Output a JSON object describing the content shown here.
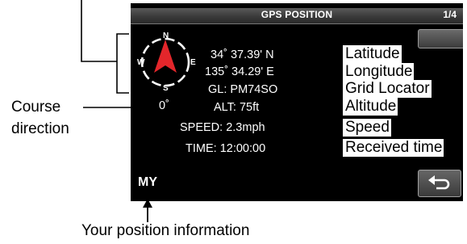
{
  "screen": {
    "title": "GPS POSITION",
    "page": "1/4",
    "latitude": "34˚ 37.39' N",
    "longitude": "135˚ 34.29' E",
    "grid_locator": "GL: PM74SO",
    "altitude": "ALT: 75ft",
    "speed": "SPEED: 2.3mph",
    "time": "TIME: 12:00:00",
    "course": "0˚",
    "position_source": "MY",
    "compass": {
      "n": "N",
      "e": "E",
      "s": "S",
      "w": "W"
    }
  },
  "callouts": {
    "latitude": "Latitude",
    "longitude": "Longitude",
    "grid_locator": "Grid Locator",
    "altitude": "Altitude",
    "speed": "Speed",
    "received_time": "Received time",
    "course_direction_line1": "Course",
    "course_direction_line2": "direction",
    "your_position": "Your position information"
  },
  "colors": {
    "screen_bg": "#000000",
    "compass_arrow": "#e3262b",
    "text": "#ffffff"
  },
  "icons": {
    "back": "back-arrow-icon",
    "compass": "compass-icon"
  }
}
